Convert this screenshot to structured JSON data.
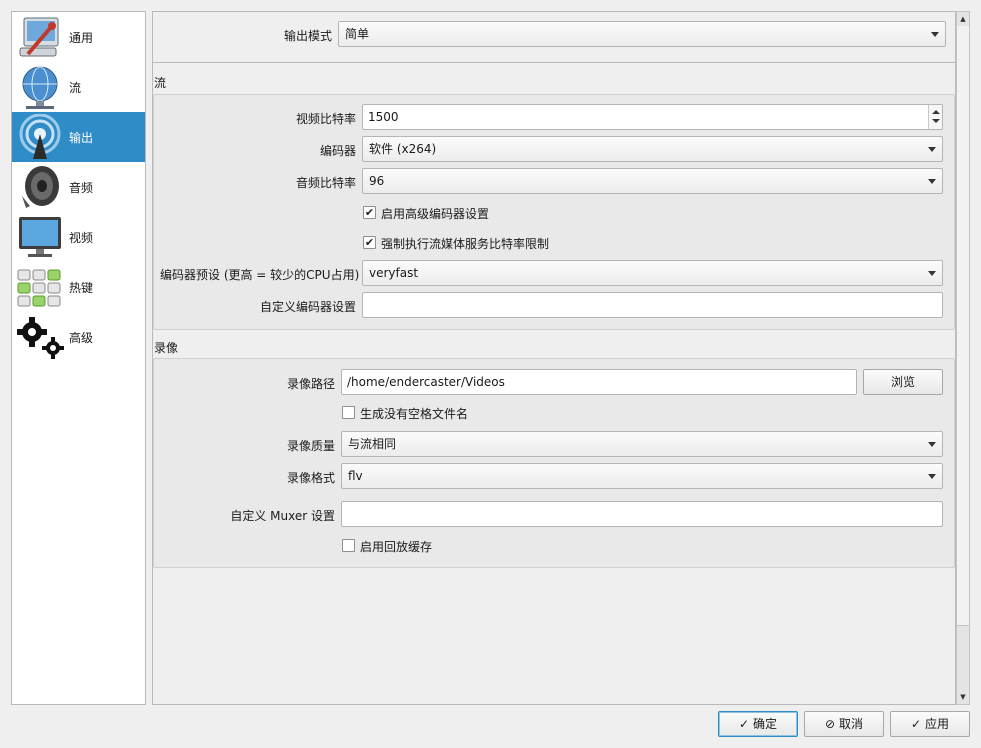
{
  "sidebar": {
    "items": [
      {
        "label": "通用",
        "icon": "general-settings-icon"
      },
      {
        "label": "流",
        "icon": "stream-globe-icon"
      },
      {
        "label": "输出",
        "icon": "output-broadcast-icon"
      },
      {
        "label": "音频",
        "icon": "speaker-icon"
      },
      {
        "label": "视频",
        "icon": "monitor-icon"
      },
      {
        "label": "热键",
        "icon": "keyboard-icon"
      },
      {
        "label": "高级",
        "icon": "gears-icon"
      }
    ],
    "active_index": 2,
    "active_color": "#308cc6"
  },
  "output_mode": {
    "label": "输出模式",
    "value": "简单"
  },
  "stream": {
    "title": "流",
    "video_bitrate": {
      "label": "视频比特率",
      "value": "1500"
    },
    "encoder": {
      "label": "编码器",
      "value": "软件 (x264)"
    },
    "audio_bitrate": {
      "label": "音频比特率",
      "value": "96"
    },
    "advanced_encoder": {
      "label": "启用高级编码器设置",
      "checked": true
    },
    "enforce_limits": {
      "label": "强制执行流媒体服务比特率限制",
      "checked": true
    },
    "preset": {
      "label": "编码器预设 (更高 = 较少的CPU占用)",
      "value": "veryfast"
    },
    "custom_encoder": {
      "label": "自定义编码器设置",
      "value": ""
    }
  },
  "recording": {
    "title": "录像",
    "path": {
      "label": "录像路径",
      "value": "/home/endercaster/Videos"
    },
    "browse_label": "浏览",
    "no_space": {
      "label": "生成没有空格文件名",
      "checked": false
    },
    "quality": {
      "label": "录像质量",
      "value": "与流相同"
    },
    "format": {
      "label": "录像格式",
      "value": "flv"
    },
    "muxer": {
      "label": "自定义 Muxer 设置",
      "value": ""
    },
    "replay_buffer": {
      "label": "启用回放缓存",
      "checked": false
    }
  },
  "buttons": {
    "ok": "确定",
    "cancel": "取消",
    "apply": "应用"
  },
  "check_glyph": "✔"
}
